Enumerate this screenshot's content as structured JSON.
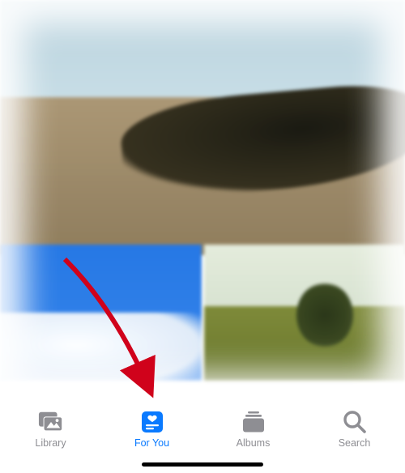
{
  "tabs": {
    "library": {
      "label": "Library",
      "icon": "library-icon",
      "active": false
    },
    "for_you": {
      "label": "For You",
      "icon": "for-you-icon",
      "active": true
    },
    "albums": {
      "label": "Albums",
      "icon": "albums-icon",
      "active": false
    },
    "search": {
      "label": "Search",
      "icon": "search-icon",
      "active": false
    }
  },
  "colors": {
    "active": "#0a7aff",
    "inactive": "#8e8e93"
  },
  "annotation": {
    "type": "arrow",
    "color": "#d0021b",
    "target": "for_you"
  }
}
